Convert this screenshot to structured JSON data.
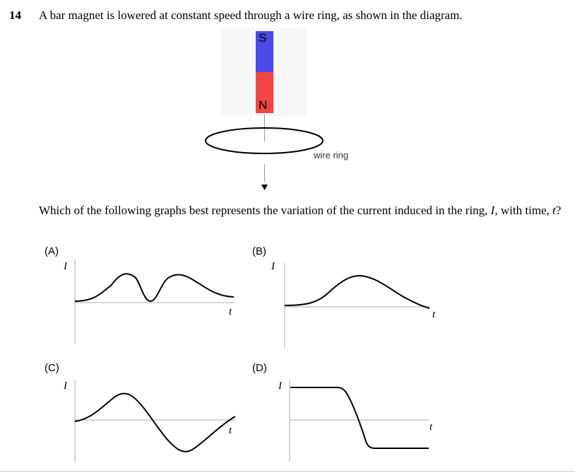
{
  "question": {
    "number": "14",
    "stem": "A bar magnet is lowered at constant speed through a wire ring, as shown in the diagram.",
    "prompt_line1": "Which of the following graphs best represents the variation of the current induced in the ring, ",
    "prompt_var": "I",
    "prompt_line2": ", with time, ",
    "prompt_t": "t",
    "prompt_end": "?"
  },
  "diagram": {
    "south_label": "S",
    "north_label": "N",
    "ring_label": "wire ring",
    "colors": {
      "south": "#4a4ae8",
      "north": "#f04545"
    }
  },
  "options": [
    {
      "letter": "(A)",
      "y_label": "I",
      "x_label": "t"
    },
    {
      "letter": "(B)",
      "y_label": "I",
      "x_label": "t"
    },
    {
      "letter": "(C)",
      "y_label": "I",
      "x_label": "t"
    },
    {
      "letter": "(D)",
      "y_label": "I",
      "x_label": "t"
    }
  ]
}
